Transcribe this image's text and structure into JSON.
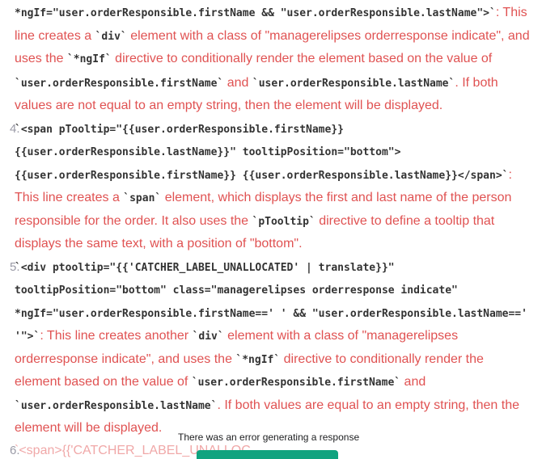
{
  "lines": [
    {
      "num": "",
      "parts": [
        {
          "t": "code",
          "v": "*ngIf=\"user.orderResponsible.firstName && \"user.orderResponsible.lastName\">`"
        },
        {
          "t": "text",
          "v": ": This"
        }
      ]
    },
    {
      "num": "",
      "parts": [
        {
          "t": "text",
          "v": "line creates a "
        },
        {
          "t": "code",
          "v": "`div`"
        },
        {
          "t": "text",
          "v": " element with a class of \"managerelipses orderresponse indicate\", and"
        }
      ]
    },
    {
      "num": "",
      "parts": [
        {
          "t": "text",
          "v": "uses the "
        },
        {
          "t": "code",
          "v": "`*ngIf`"
        },
        {
          "t": "text",
          "v": " directive to conditionally render the element based on the value of"
        }
      ]
    },
    {
      "num": "",
      "parts": [
        {
          "t": "code",
          "v": "`user.orderResponsible.firstName`"
        },
        {
          "t": "text",
          "v": " and "
        },
        {
          "t": "code",
          "v": "`user.orderResponsible.lastName`"
        },
        {
          "t": "text",
          "v": ". If both"
        }
      ]
    },
    {
      "num": "",
      "parts": [
        {
          "t": "text",
          "v": "values are not equal to an empty string, then the element will be displayed."
        }
      ]
    },
    {
      "num": "4.",
      "parts": [
        {
          "t": "code",
          "v": "`<span pTooltip=\"{{user.orderResponsible.firstName}}"
        }
      ]
    },
    {
      "num": "",
      "parts": [
        {
          "t": "code",
          "v": "{{user.orderResponsible.lastName}}\" tooltipPosition=\"bottom\">"
        }
      ]
    },
    {
      "num": "",
      "parts": [
        {
          "t": "code",
          "v": "{{user.orderResponsible.firstName}} {{user.orderResponsible.lastName}}</span>`"
        },
        {
          "t": "text",
          "v": ":"
        }
      ]
    },
    {
      "num": "",
      "parts": [
        {
          "t": "text",
          "v": "This line creates a "
        },
        {
          "t": "code",
          "v": "`span`"
        },
        {
          "t": "text",
          "v": " element, which displays the first and last name of the person"
        }
      ]
    },
    {
      "num": "",
      "parts": [
        {
          "t": "text",
          "v": "responsible for the order. It also uses the "
        },
        {
          "t": "code",
          "v": "`pTooltip`"
        },
        {
          "t": "text",
          "v": " directive to define a tooltip that"
        }
      ]
    },
    {
      "num": "",
      "parts": [
        {
          "t": "text",
          "v": "displays the same text, with a position of \"bottom\"."
        }
      ]
    },
    {
      "num": "5.",
      "parts": [
        {
          "t": "code",
          "v": "`<div ptooltip=\"{{'CATCHER_LABEL_UNALLOCATED' | translate}}\""
        }
      ]
    },
    {
      "num": "",
      "parts": [
        {
          "t": "code",
          "v": "tooltipPosition=\"bottom\" class=\"managerelipses orderresponse indicate\""
        }
      ]
    },
    {
      "num": "",
      "parts": [
        {
          "t": "code",
          "v": "*ngIf=\"user.orderResponsible.firstName==' ' && \"user.orderResponsible.lastName=='"
        }
      ]
    },
    {
      "num": "",
      "parts": [
        {
          "t": "code",
          "v": "'\">`"
        },
        {
          "t": "text",
          "v": ": This line creates another "
        },
        {
          "t": "code",
          "v": "`div`"
        },
        {
          "t": "text",
          "v": " element with a class of \"managerelipses"
        }
      ]
    },
    {
      "num": "",
      "parts": [
        {
          "t": "text",
          "v": "orderresponse indicate\", and uses the "
        },
        {
          "t": "code",
          "v": "`*ngIf`"
        },
        {
          "t": "text",
          "v": " directive to conditionally render the"
        }
      ]
    },
    {
      "num": "",
      "parts": [
        {
          "t": "text",
          "v": "element based on the value of "
        },
        {
          "t": "code",
          "v": "`user.orderResponsible.firstName`"
        },
        {
          "t": "text",
          "v": " and"
        }
      ]
    },
    {
      "num": "",
      "parts": [
        {
          "t": "code",
          "v": "`user.orderResponsible.lastName`"
        },
        {
          "t": "text",
          "v": ". If both values are equal to an empty string, then the"
        }
      ]
    },
    {
      "num": "",
      "parts": [
        {
          "t": "text",
          "v": "element will be displayed."
        }
      ]
    },
    {
      "num": "6.",
      "faded": true,
      "parts": [
        {
          "t": "text",
          "v": "`<span>{{'CATCHER_LABEL_UNALLOC"
        }
      ]
    }
  ],
  "error_message": "There was an error generating a response",
  "colors": {
    "text": "#e05252",
    "code": "#333333",
    "button": "#10a37f"
  }
}
